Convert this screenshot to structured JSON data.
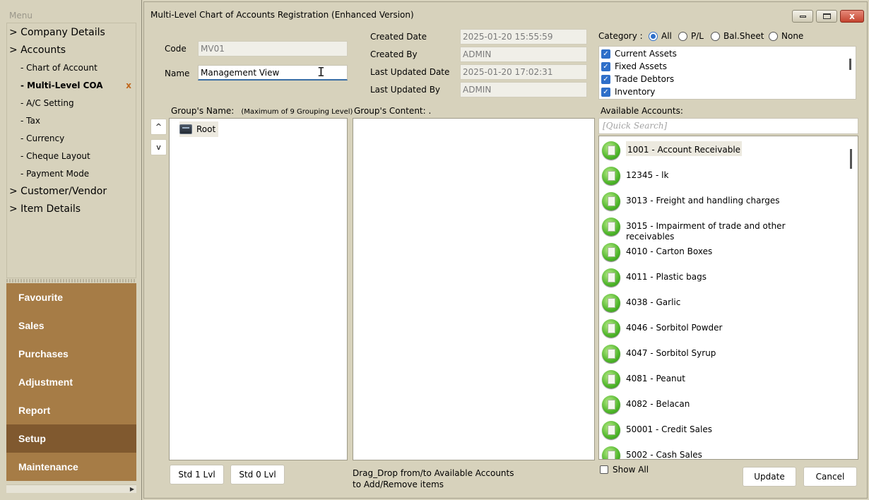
{
  "menu": {
    "header": "Menu",
    "tree": [
      {
        "label": "> Company Details",
        "level": "top"
      },
      {
        "label": "> Accounts",
        "level": "top"
      },
      {
        "label": "- Chart of Account",
        "level": "sub"
      },
      {
        "label": "- Multi-Level COA",
        "level": "sub",
        "active": true,
        "close": "x"
      },
      {
        "label": "- A/C Setting",
        "level": "sub"
      },
      {
        "label": "- Tax",
        "level": "sub"
      },
      {
        "label": "- Currency",
        "level": "sub"
      },
      {
        "label": "- Cheque Layout",
        "level": "sub"
      },
      {
        "label": "- Payment Mode",
        "level": "sub"
      },
      {
        "label": "> Customer/Vendor",
        "level": "top"
      },
      {
        "label": "> Item Details",
        "level": "top"
      }
    ],
    "nav": [
      "Favourite",
      "Sales",
      "Purchases",
      "Adjustment",
      "Report",
      "Setup",
      "Maintenance"
    ],
    "active_nav": "Setup"
  },
  "window": {
    "title": "Multi-Level Chart of Accounts Registration (Enhanced Version)",
    "close_glyph": "x"
  },
  "form": {
    "code_label": "Code",
    "code_value": "MV01",
    "name_label": "Name",
    "name_value": "Management View",
    "created_date_label": "Created Date",
    "created_date_value": "2025-01-20 15:55:59",
    "created_by_label": "Created By",
    "created_by_value": "ADMIN",
    "last_updated_date_label": "Last Updated Date",
    "last_updated_date_value": "2025-01-20 17:02:31",
    "last_updated_by_label": "Last Updated By",
    "last_updated_by_value": "ADMIN"
  },
  "category": {
    "label": "Category :",
    "options": [
      "All",
      "P/L",
      "Bal.Sheet",
      "None"
    ],
    "selected": "All",
    "items": [
      "Current Assets",
      "Fixed Assets",
      "Trade Debtors",
      "Inventory"
    ]
  },
  "groups": {
    "name_label": "Group's Name:",
    "name_hint": "(Maximum of 9 Grouping Level)",
    "content_label": "Group's Content: .",
    "up_label": "^",
    "down_label": "v",
    "root_label": "Root",
    "std1_label": "Std 1 Lvl",
    "std0_label": "Std 0 Lvl",
    "drag_hint_1": "Drag_Drop from/to Available Accounts",
    "drag_hint_2": "to Add/Remove items"
  },
  "available": {
    "label": "Available Accounts:",
    "search_placeholder": "[Quick Search]",
    "accounts": [
      "1001 - Account Receivable",
      "12345 - lk",
      "3013 - Freight and handling charges",
      "3015 - Impairment of trade and other receivables",
      "4010 - Carton Boxes",
      "4011 - Plastic bags",
      "4038 - Garlic",
      "4046 - Sorbitol Powder",
      "4047 - Sorbitol Syrup",
      "4081 - Peanut",
      "4082 - Belacan",
      "50001 - Credit Sales",
      "5002 - Cash Sales"
    ],
    "selected_index": 0,
    "show_all_label": "Show All"
  },
  "actions": {
    "update_label": "Update",
    "cancel_label": "Cancel"
  }
}
